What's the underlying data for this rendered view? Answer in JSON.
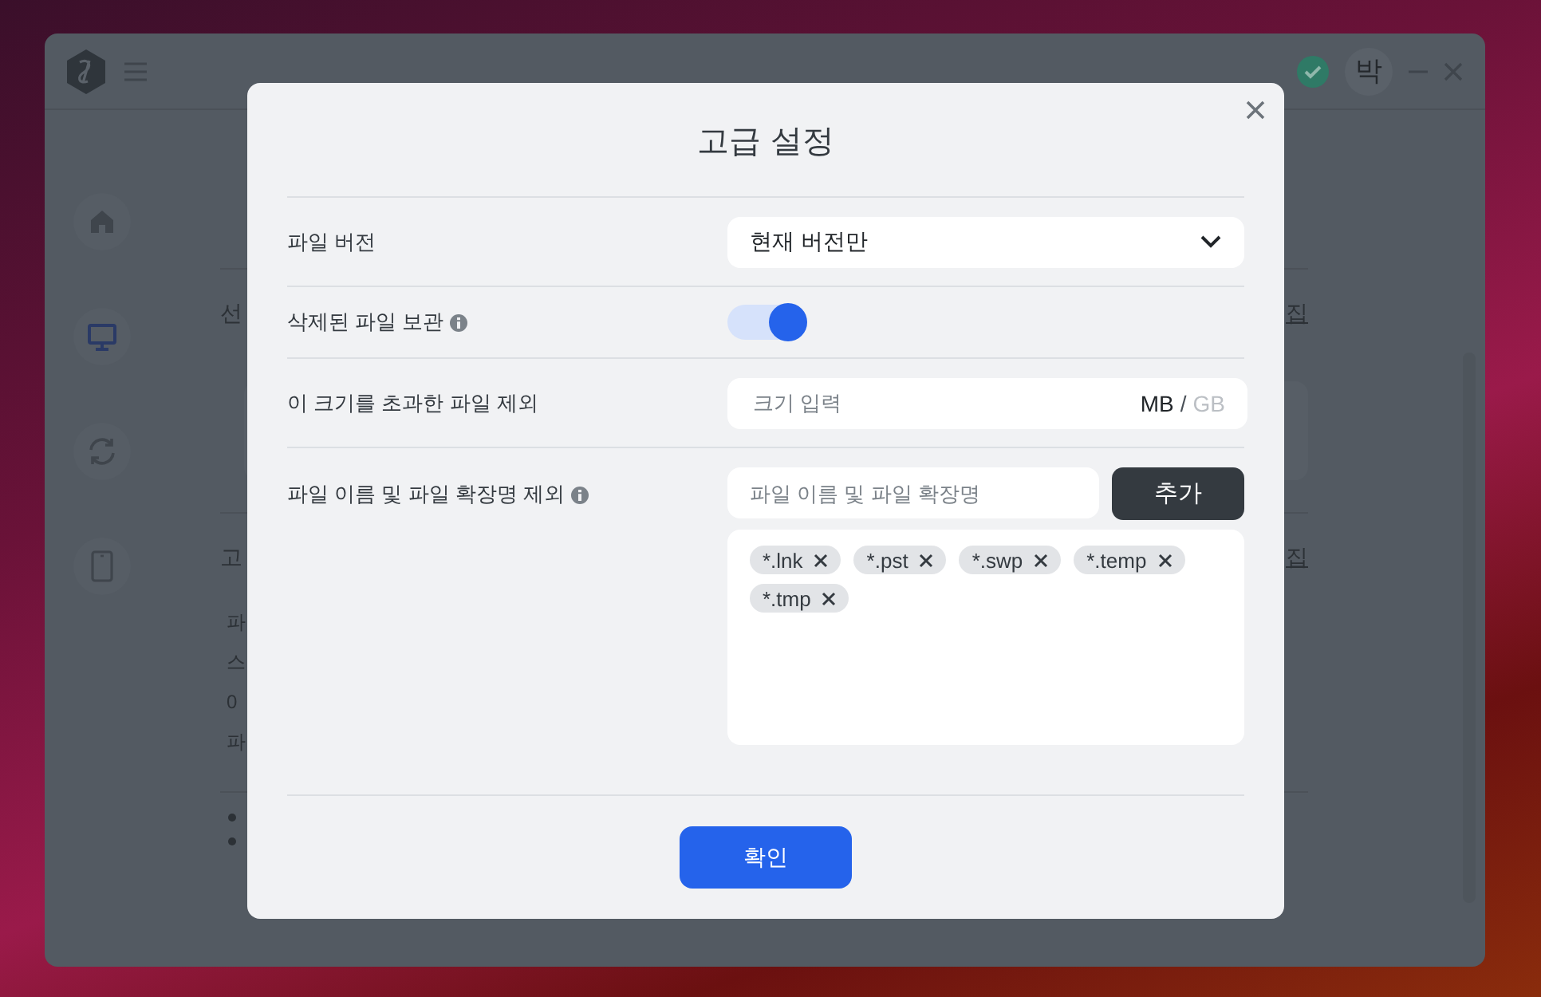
{
  "app": {
    "avatar": "박",
    "sidebar": [
      {
        "kind": "home",
        "selected": false
      },
      {
        "kind": "monitor",
        "selected": true
      },
      {
        "kind": "sync",
        "selected": false
      },
      {
        "kind": "phone",
        "selected": false
      }
    ],
    "content": {
      "section_1_title": "선",
      "section_1_link": "집",
      "section_2_title": "고",
      "section_2_link": "집",
      "section_2_lines": [
        "파",
        "스",
        "0",
        "파"
      ]
    }
  },
  "dialog": {
    "title": "고급 설정",
    "rows": [
      {
        "kind": "select",
        "label": "파일 버전",
        "value": "현재 버전만"
      },
      {
        "kind": "toggle",
        "label": "삭제된 파일 보관",
        "info": true,
        "on": true
      },
      {
        "kind": "size",
        "label": "이 크기를 초과한 파일 제외",
        "placeholder": "크기 입력",
        "unit_separator": "/",
        "units": [
          {
            "label": "MB",
            "selected": true
          },
          {
            "label": "GB",
            "selected": false
          }
        ]
      },
      {
        "kind": "exclude",
        "label": "파일 이름 및 파일 확장명 제외",
        "info": true,
        "placeholder": "파일 이름 및 파일 확장명",
        "button": "추가",
        "tags": [
          "*.lnk",
          "*.pst",
          "*.swp",
          "*.temp",
          "*.tmp"
        ]
      }
    ],
    "confirm": "확인"
  }
}
